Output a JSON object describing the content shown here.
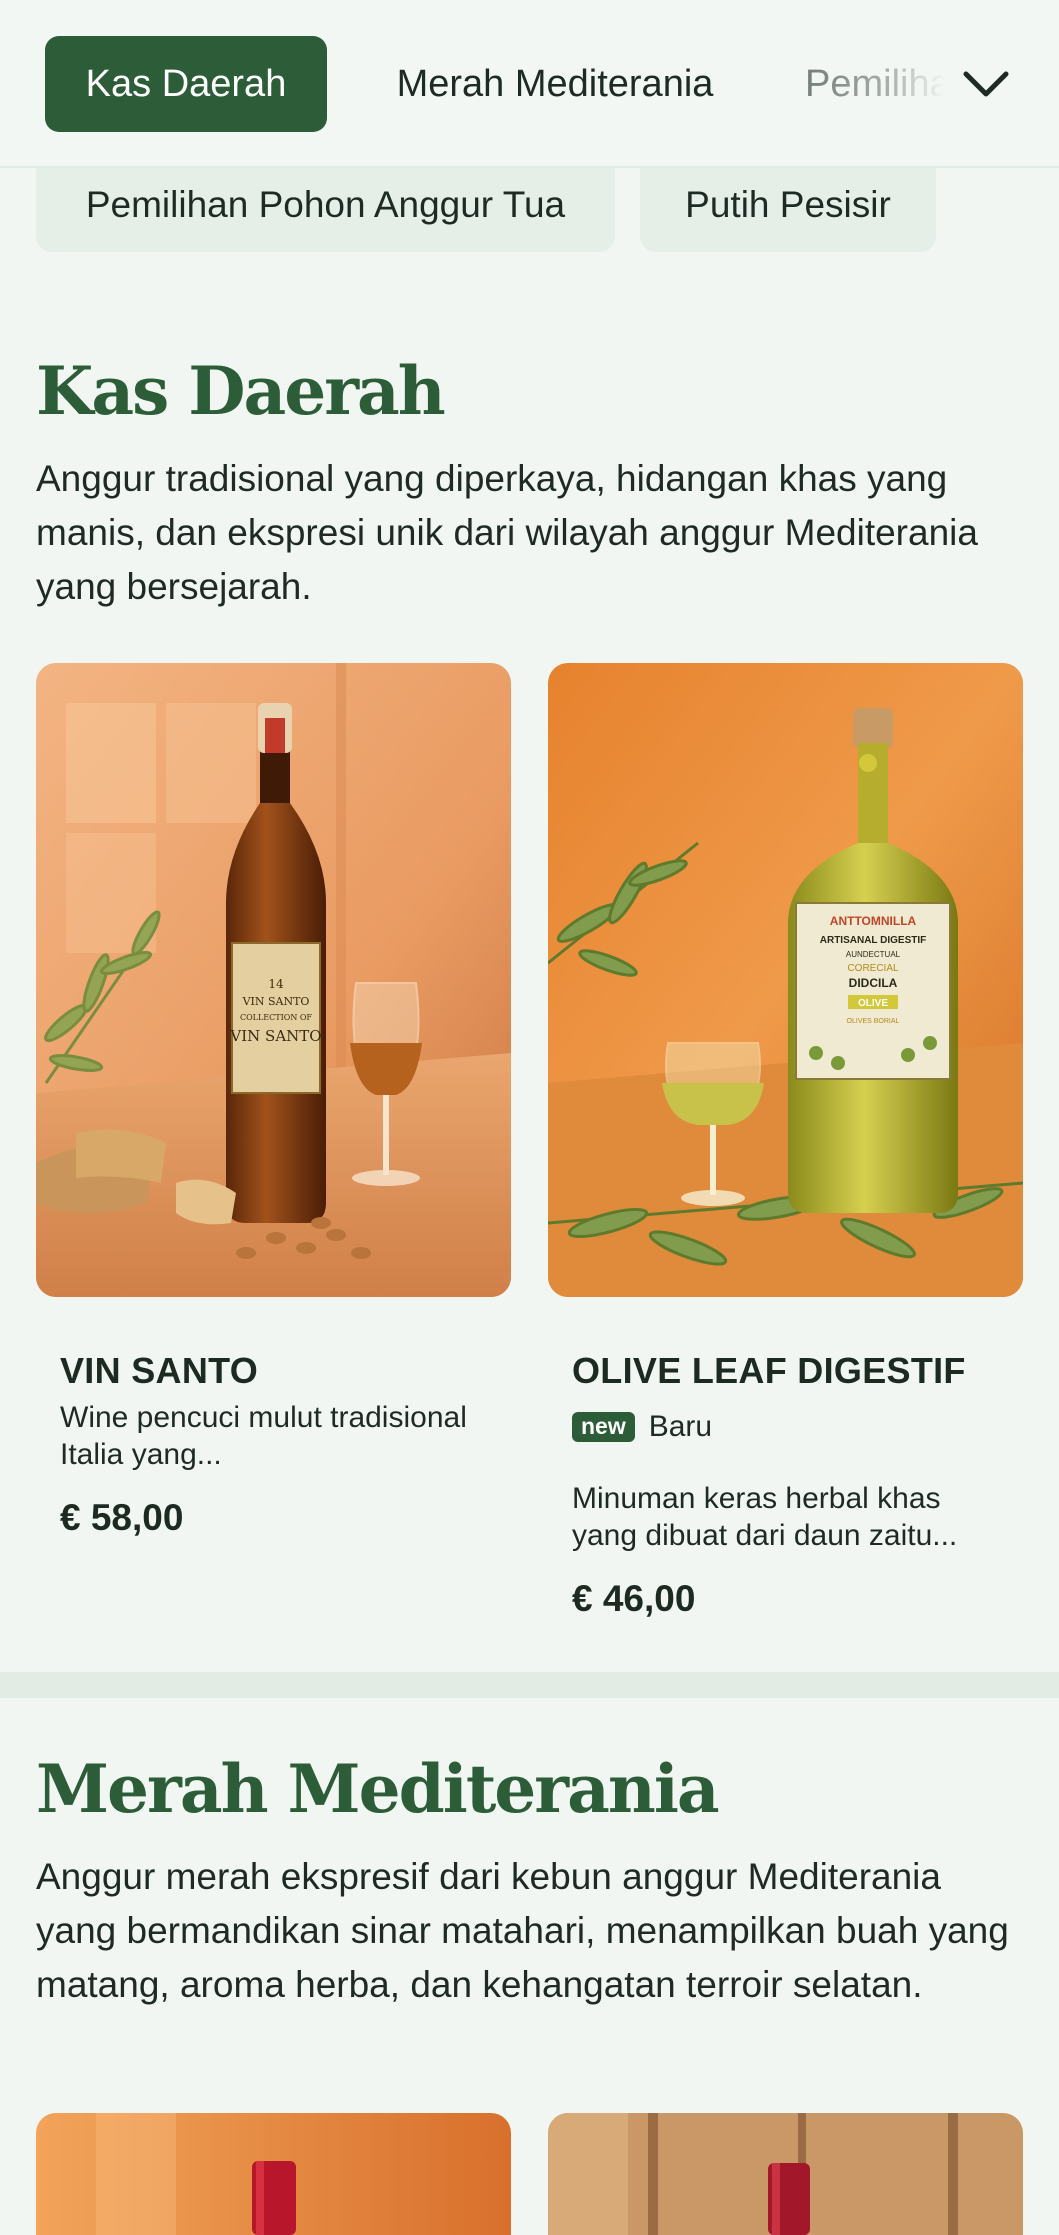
{
  "nav": {
    "tabs": [
      "Kas Daerah",
      "Merah Mediterania",
      "Pemilihan"
    ],
    "active_index": 0,
    "expand_icon": "chevron-down-icon"
  },
  "subnav": {
    "pills": [
      "Pemilihan Pohon Anggur Tua",
      "Putih Pesisir"
    ]
  },
  "sections": [
    {
      "title": "Kas Daerah",
      "description": "Anggur tradisional yang diperkaya, hidangan khas yang manis, dan ekspresi unik dari wilayah anggur Mediterania yang bersejarah.",
      "products": [
        {
          "name": "VIN SANTO",
          "description": "Wine pencuci mulut tradisional Italia yang...",
          "price": "€ 58,00",
          "label_lines": [
            "14",
            "VIN SANTO",
            "COLLECTION OF",
            "VIN SANTO"
          ]
        },
        {
          "name": "OLIVE LEAF DIGESTIF",
          "badge": "new",
          "badge_text": "Baru",
          "description": "Minuman keras herbal khas yang dibuat dari daun zaitu...",
          "price": "€ 46,00",
          "label_lines": [
            "ANTTOMNILLA",
            "ARTISANAL DIGESTIF",
            "AUNDECTUAL",
            "CORECIAL",
            "DIDCILA",
            "OLIVE",
            "OLIVES BORIAL"
          ]
        }
      ]
    },
    {
      "title": "Merah Mediterania",
      "description": "Anggur merah ekspresif dari kebun anggur Mediterania yang bermandikan sinar matahari, menampilkan buah yang matang, aroma herba, dan kehangatan terroir selatan."
    }
  ],
  "colors": {
    "accent": "#2c5c38",
    "background": "#f1f6f2",
    "pill_bg": "#e6eee8"
  }
}
